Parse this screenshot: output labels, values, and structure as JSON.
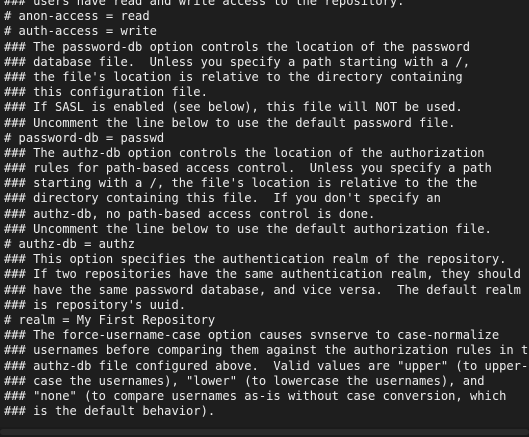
{
  "editor": {
    "lines": [
      "### users have read and write access to the repository.",
      "# anon-access = read",
      "# auth-access = write",
      "### The password-db option controls the location of the password",
      "### database file.  Unless you specify a path starting with a /,",
      "### the file's location is relative to the directory containing",
      "### this configuration file.",
      "### If SASL is enabled (see below), this file will NOT be used.",
      "### Uncomment the line below to use the default password file.",
      "# password-db = passwd",
      "### The authz-db option controls the location of the authorization",
      "### rules for path-based access control.  Unless you specify a path",
      "### starting with a /, the file's location is relative to the the",
      "### directory containing this file.  If you don't specify an",
      "### authz-db, no path-based access control is done.",
      "### Uncomment the line below to use the default authorization file.",
      "# authz-db = authz",
      "### This option specifies the authentication realm of the repository.",
      "### If two repositories have the same authentication realm, they should",
      "### have the same password database, and vice versa.  The default realm",
      "### is repository's uuid.",
      "# realm = My First Repository",
      "### The force-username-case option causes svnserve to case-normalize",
      "### usernames before comparing them against the authorization rules in the",
      "### authz-db file configured above.  Valid values are \"upper\" (to upper-",
      "### case the usernames), \"lower\" (to lowercase the usernames), and",
      "### \"none\" (to compare usernames as-is without case conversion, which",
      "### is the default behavior)."
    ]
  }
}
